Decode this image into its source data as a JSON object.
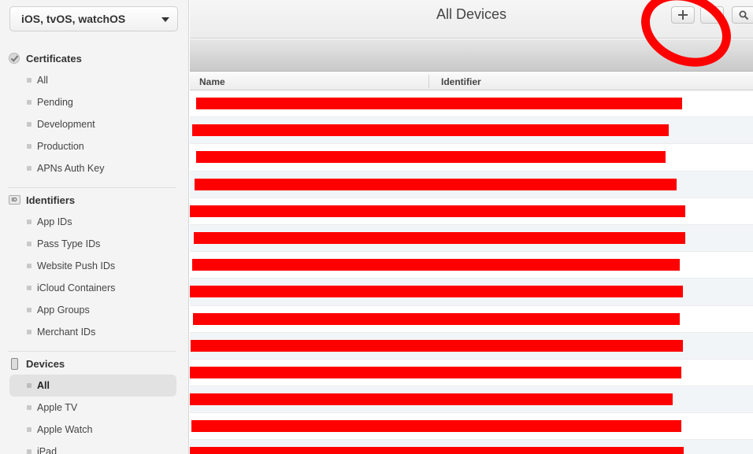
{
  "sidebar": {
    "platform": "iOS, tvOS, watchOS",
    "sections": [
      {
        "title": "Certificates",
        "icon": "certificate-icon",
        "items": [
          "All",
          "Pending",
          "Development",
          "Production",
          "APNs Auth Key"
        ]
      },
      {
        "title": "Identifiers",
        "icon": "id-badge-icon",
        "items": [
          "App IDs",
          "Pass Type IDs",
          "Website Push IDs",
          "iCloud Containers",
          "App Groups",
          "Merchant IDs"
        ]
      },
      {
        "title": "Devices",
        "icon": "iphone-icon",
        "items": [
          "All",
          "Apple TV",
          "Apple Watch",
          "iPad"
        ],
        "selected": "All"
      }
    ]
  },
  "header": {
    "title": "All Devices",
    "buttons": [
      "plus-icon",
      "edit-icon",
      "search-icon"
    ]
  },
  "table": {
    "columns": [
      "Name",
      "Identifier"
    ],
    "row_count_visible": 14,
    "row_content": "redacted"
  },
  "colors": {
    "redaction": "#ff0000",
    "annotation_circle": "#ff0000",
    "selected_row_bg": "#e2e2e2"
  }
}
